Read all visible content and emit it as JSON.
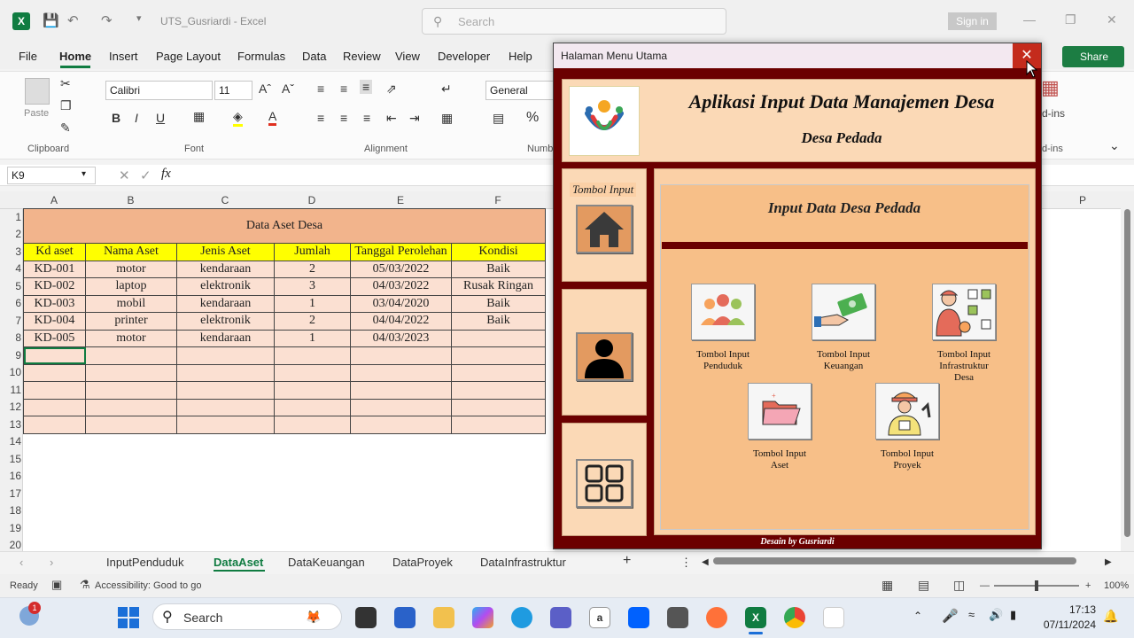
{
  "window": {
    "doc_title": "UTS_Gusriardi  -  Excel",
    "search_placeholder": "Search",
    "sign_in": "Sign in",
    "share": "Share"
  },
  "menu": [
    "File",
    "Home",
    "Insert",
    "Page Layout",
    "Formulas",
    "Data",
    "Review",
    "View",
    "Developer",
    "Help"
  ],
  "ribbon": {
    "paste": "Paste",
    "clipboard": "Clipboard",
    "font_group": "Font",
    "alignment": "Alignment",
    "number_group": "Numb",
    "font_name": "Calibri",
    "font_size": "11",
    "number_format": "General",
    "addins": "d-ins",
    "addins2": "d-ins"
  },
  "formula_bar": {
    "name_box": "K9",
    "fx": "fx"
  },
  "columns": [
    "A",
    "B",
    "C",
    "D",
    "E",
    "F",
    "P"
  ],
  "rows": [
    "1",
    "2",
    "3",
    "4",
    "5",
    "6",
    "7",
    "8",
    "9",
    "10",
    "11",
    "12",
    "13",
    "14",
    "15",
    "16",
    "17",
    "18",
    "19",
    "20"
  ],
  "table": {
    "title": "Data Aset Desa",
    "headers": [
      "Kd aset",
      "Nama Aset",
      "Jenis Aset",
      "Jumlah",
      "Tanggal Perolehan",
      "Kondisi"
    ],
    "rows": [
      [
        "KD-001",
        "motor",
        "kendaraan",
        "2",
        "05/03/2022",
        "Baik"
      ],
      [
        "KD-002",
        "laptop",
        "elektronik",
        "3",
        "04/03/2022",
        "Rusak Ringan"
      ],
      [
        "KD-003",
        "mobil",
        "kendaraan",
        "1",
        "03/04/2020",
        "Baik"
      ],
      [
        "KD-004",
        "printer",
        "elektronik",
        "2",
        "04/04/2022",
        "Baik"
      ],
      [
        "KD-005",
        "motor",
        "kendaraan",
        "1",
        "04/03/2023",
        ""
      ]
    ]
  },
  "sheet_tabs": [
    "InputPenduduk",
    "DataAset",
    "DataKeuangan",
    "DataProyek",
    "DataInfrastruktur"
  ],
  "status": {
    "ready": "Ready",
    "accessibility": "Accessibility: Good to go",
    "zoom": "100%"
  },
  "form": {
    "title": "Halaman Menu Utama",
    "app_title": "Aplikasi Input Data Manajemen Desa",
    "app_subtitle": "Desa Pedada",
    "frame_label": "Tombol Input",
    "frame_heading": "Input Data Desa Pedada",
    "buttons": [
      {
        "label1": "Tombol Input",
        "label2": "Penduduk",
        "label3": ""
      },
      {
        "label1": "Tombol Input",
        "label2": "Keuangan",
        "label3": ""
      },
      {
        "label1": "Tombol Input",
        "label2": "Infrastruktur",
        "label3": "Desa"
      },
      {
        "label1": "Tombol Input",
        "label2": "Aset",
        "label3": ""
      },
      {
        "label1": "Tombol Input",
        "label2": "Proyek",
        "label3": ""
      }
    ],
    "footer": "Desain by Gusriardi"
  },
  "taskbar": {
    "search": "Search",
    "time": "17:13",
    "date": "07/11/2024",
    "notif_badge": "1"
  },
  "colors": {
    "excel_green": "#107c41",
    "form_border": "#6b0000",
    "peach": "#f7bf88",
    "header_yellow": "#ffff00",
    "title_orange": "#f2b48c"
  }
}
